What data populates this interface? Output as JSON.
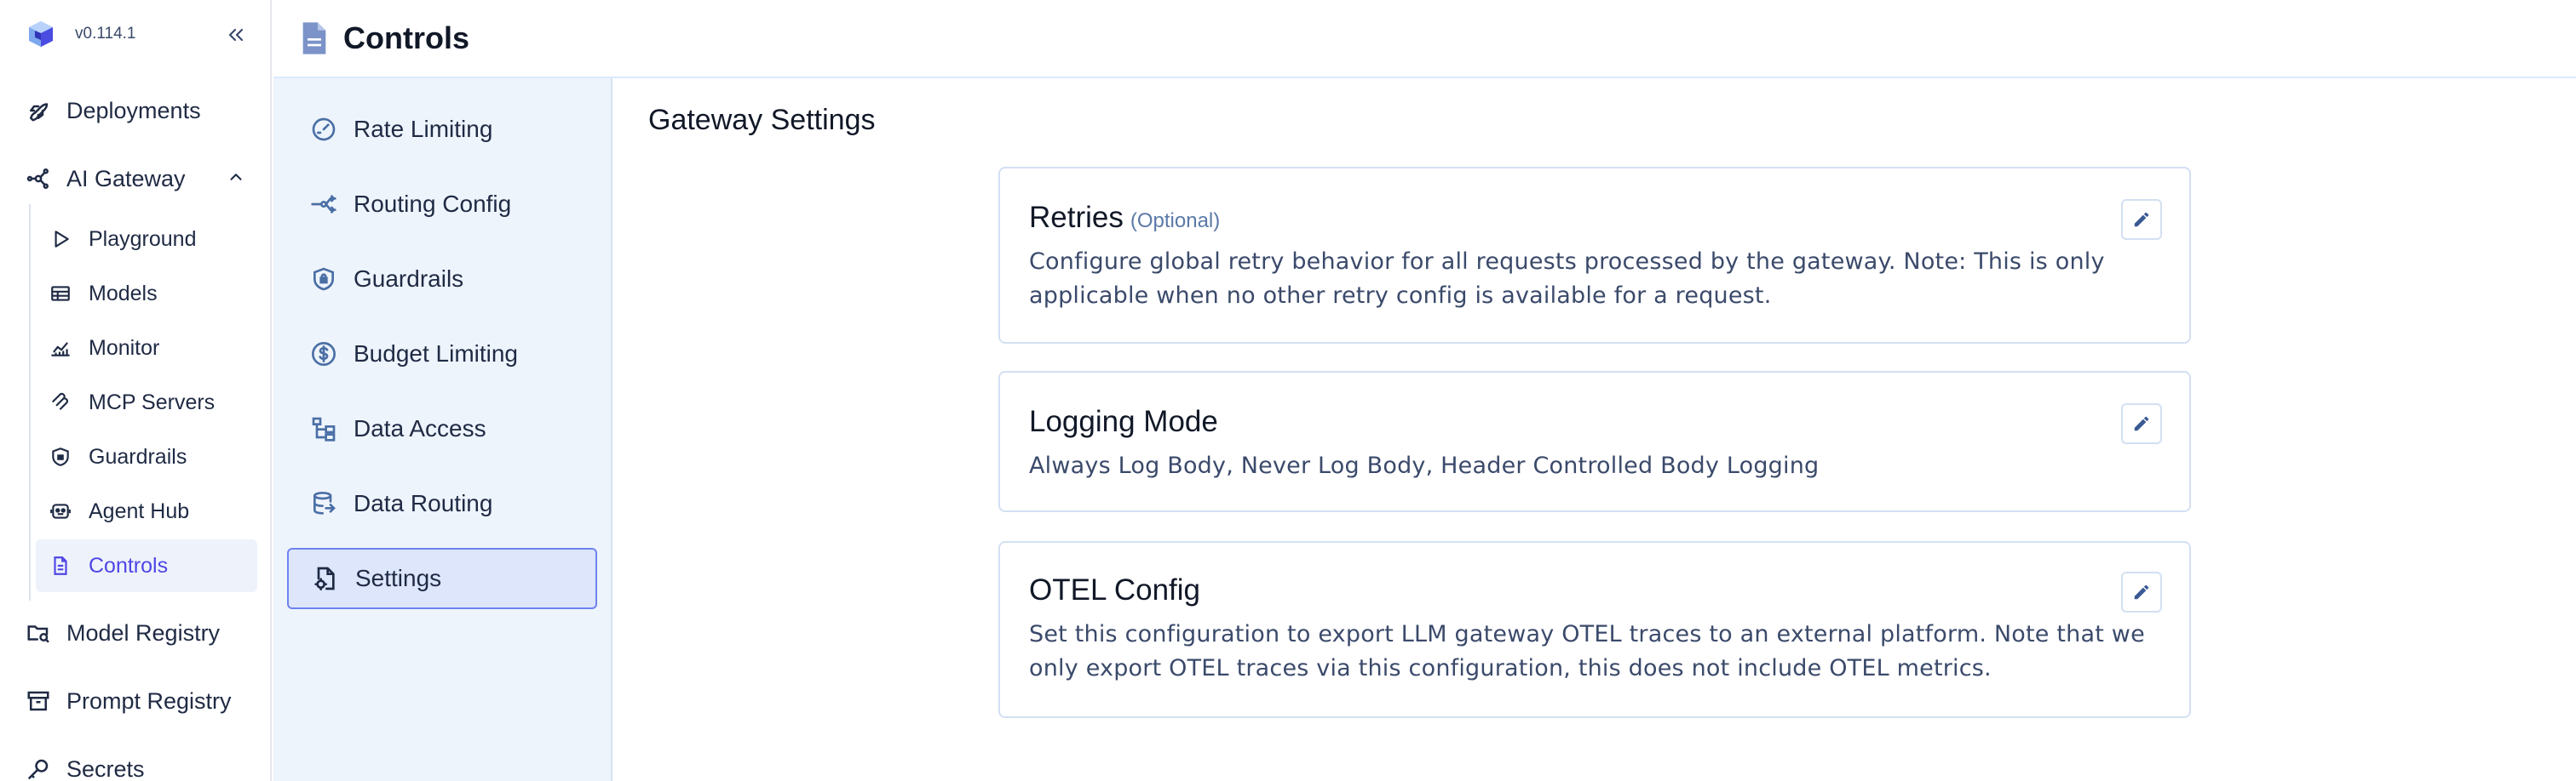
{
  "brand": {
    "version": "v0.114.1",
    "logo_icon": "truefoundry-cube-logo"
  },
  "nav": {
    "collapse_icon": "double-chevron-left-icon",
    "items_top": [
      {
        "label": "Deployments",
        "icon": "rocket-icon"
      },
      {
        "label": "AI Gateway",
        "icon": "gateway-nodes-icon",
        "expanded": true
      }
    ],
    "ai_gateway_children": [
      {
        "label": "Playground",
        "icon": "play-icon"
      },
      {
        "label": "Models",
        "icon": "table-icon"
      },
      {
        "label": "Monitor",
        "icon": "chart-line-icon"
      },
      {
        "label": "MCP Servers",
        "icon": "mcp-icon"
      },
      {
        "label": "Guardrails",
        "icon": "shield-icon"
      },
      {
        "label": "Agent Hub",
        "icon": "robot-icon"
      },
      {
        "label": "Controls",
        "icon": "document-icon",
        "active": true
      }
    ],
    "items_bottom": [
      {
        "label": "Model Registry",
        "icon": "folder-search-icon"
      },
      {
        "label": "Prompt Registry",
        "icon": "archive-icon"
      },
      {
        "label": "Secrets",
        "icon": "key-icon"
      }
    ]
  },
  "header": {
    "title": "Controls",
    "icon": "document-icon"
  },
  "controls_menu": [
    {
      "label": "Rate Limiting",
      "icon": "gauge-icon"
    },
    {
      "label": "Routing Config",
      "icon": "routing-icon"
    },
    {
      "label": "Guardrails",
      "icon": "shield-lock-icon"
    },
    {
      "label": "Budget Limiting",
      "icon": "dollar-circle-icon"
    },
    {
      "label": "Data Access",
      "icon": "hierarchy-icon"
    },
    {
      "label": "Data Routing",
      "icon": "database-route-icon"
    },
    {
      "label": "Settings",
      "icon": "file-settings-icon",
      "active": true
    }
  ],
  "main": {
    "section_title": "Gateway Settings",
    "cards": [
      {
        "title": "Retries",
        "optional": "(Optional)",
        "description": "Configure global retry behavior for all requests processed by the gateway. Note: This is only applicable when no other retry config is available for a request.",
        "edit_icon": "pencil-icon"
      },
      {
        "title": "Logging Mode",
        "optional": "",
        "description": "Always Log Body, Never Log Body, Header Controlled Body Logging",
        "edit_icon": "pencil-icon"
      },
      {
        "title": "OTEL Config",
        "optional": "",
        "description": "Set this configuration to export LLM gateway OTEL traces to an external platform. Note that we only export OTEL traces via this configuration, this does not include OTEL metrics.",
        "edit_icon": "pencil-icon"
      }
    ]
  },
  "colors": {
    "accent": "#4f46e5",
    "icon": "#4a6fa5",
    "sidebar_bg": "#eef4fc",
    "active_border": "#6f82f0"
  }
}
